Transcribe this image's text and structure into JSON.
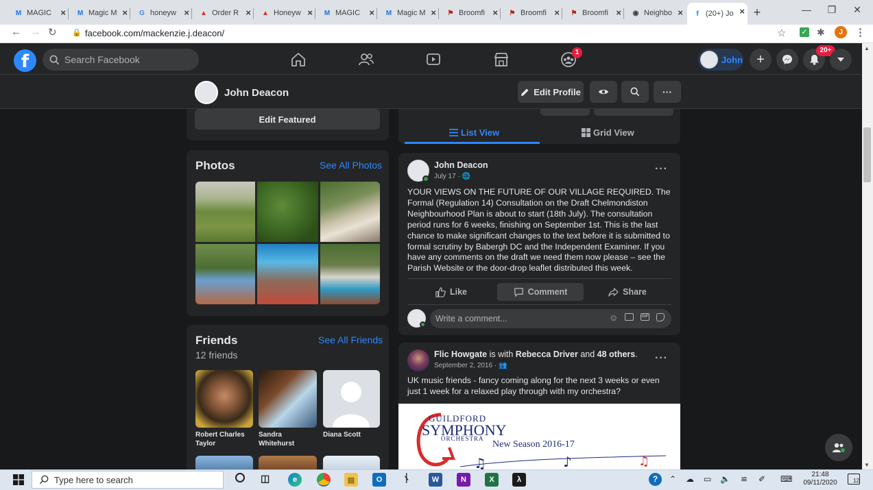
{
  "browser": {
    "tabs": [
      {
        "title": "MAGIC",
        "favicon": "M",
        "color": "#1a73e8"
      },
      {
        "title": "Magic M",
        "favicon": "M",
        "color": "#1a73e8"
      },
      {
        "title": "honeyw",
        "favicon": "G",
        "color": "#4285f4"
      },
      {
        "title": "Order R",
        "favicon": "▲",
        "color": "#d93025"
      },
      {
        "title": "Honeyw",
        "favicon": "▲",
        "color": "#d93025"
      },
      {
        "title": "MAGIC",
        "favicon": "M",
        "color": "#1a73e8"
      },
      {
        "title": "Magic M",
        "favicon": "M",
        "color": "#1a73e8"
      },
      {
        "title": "Broomfi",
        "favicon": "⚑",
        "color": "#b3261e"
      },
      {
        "title": "Broomfi",
        "favicon": "⚑",
        "color": "#b3261e"
      },
      {
        "title": "Broomfi",
        "favicon": "⚑",
        "color": "#b3261e"
      },
      {
        "title": "Neighbo",
        "favicon": "◉",
        "color": "#3c4043"
      },
      {
        "title": "(20+) Jo",
        "favicon": "f",
        "color": "#1877f2"
      }
    ],
    "url": "facebook.com/mackenzie.j.deacon/",
    "profile_initial": "J"
  },
  "fb_nav": {
    "search_placeholder": "Search Facebook",
    "groups_badge": "1",
    "user_chip": "John",
    "notifications_badge": "20+"
  },
  "profile_bar": {
    "name": "John Deacon",
    "edit_profile": "Edit Profile"
  },
  "left": {
    "edit_featured": "Edit Featured",
    "photos_title": "Photos",
    "see_all_photos": "See All Photos",
    "friends_title": "Friends",
    "friends_count": "12 friends",
    "see_all_friends": "See All Friends",
    "friends": [
      {
        "name": "Robert Charles Taylor"
      },
      {
        "name": "Sandra Whitehurst"
      },
      {
        "name": "Diana Scott"
      }
    ]
  },
  "feed": {
    "view_tabs": {
      "list": "List View",
      "grid": "Grid View"
    },
    "post1": {
      "author": "John Deacon",
      "date": "July 17",
      "text": "YOUR VIEWS ON THE FUTURE OF OUR VILLAGE REQUIRED.  The Formal (Regulation 14) Consultation on the Draft Chelmondiston Neighbourhood Plan is about to start (18th July).  The consultation period runs for 6 weeks, finishing on September 1st.  This is the last chance to make significant changes to the text before it is submitted to formal scrutiny by Babergh DC and the Independent Examiner.  If you have any comments on the draft we need them now please – see the Parish Website or the door-drop leaflet distributed this week.",
      "like": "Like",
      "comment": "Comment",
      "share": "Share",
      "comment_placeholder": "Write a comment..."
    },
    "post2": {
      "author": "Flic Howgate",
      "with_text": "is with",
      "tagged": "Rebecca Driver",
      "and_text": "and",
      "others": "48 others",
      "date": "September 2, 2016",
      "text": "UK music friends - fancy coming along for the next 3 weeks or even just 1 week for a relaxed play through with my orchestra?",
      "image_line1": "GUILDFORD",
      "image_line2": "SYMPHONY",
      "image_line3": "ORCHESTRA",
      "image_line4": "New Season 2016-17"
    }
  },
  "taskbar": {
    "search_placeholder": "Type here to search",
    "time": "21:48",
    "date": "09/11/2020",
    "notifications": "12"
  },
  "colors": {
    "fb_blue": "#2d88ff",
    "dark_bg": "#18191a",
    "card_bg": "#242526"
  }
}
